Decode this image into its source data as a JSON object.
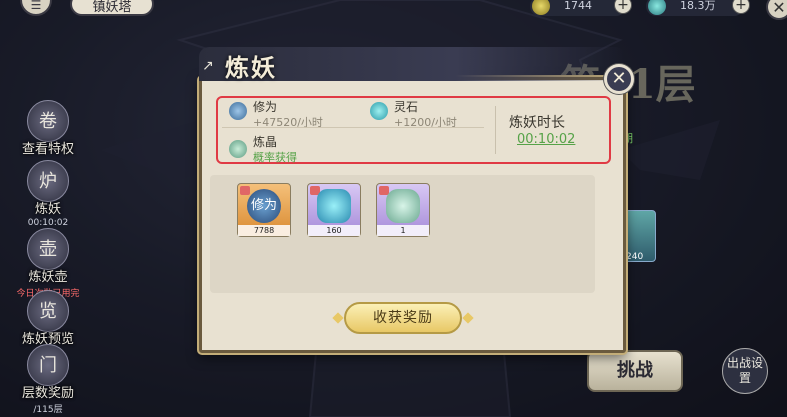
{
  "topbar": {
    "location": "镇妖塔",
    "resource_a": "1744",
    "resource_b": "18.3万"
  },
  "sidebar": {
    "items": [
      {
        "label": "查看特权",
        "sub": "",
        "icon": "scroll-icon"
      },
      {
        "label": "炼妖",
        "sub": "00:10:02",
        "icon": "furnace-icon"
      },
      {
        "label": "炼妖壶",
        "sub": "今日次数已用完",
        "icon": "gourd-icon"
      },
      {
        "label": "炼妖预览",
        "sub": "",
        "icon": "preview-icon"
      },
      {
        "label": "层数奖励",
        "sub": "/115层",
        "icon": "gate-icon"
      }
    ]
  },
  "background": {
    "layer_title": "第11层",
    "right_note": "期",
    "right_card_count": "240",
    "challenge_label": "挑战",
    "battle_setting_label": "出战设置"
  },
  "modal": {
    "title": "炼妖",
    "close_icon": "close-icon",
    "income": [
      {
        "name": "修为",
        "rate": "+47520/小时",
        "icon": "cultivation-icon"
      },
      {
        "name": "灵石",
        "rate": "+1200/小时",
        "icon": "spirit-stone-icon"
      }
    ],
    "crystal": {
      "name": "炼晶",
      "note": "概率获得",
      "icon": "crystal-icon"
    },
    "duration_label": "炼妖时长",
    "duration_value": "00:10:02",
    "rewards": [
      {
        "glyph": "修为",
        "count": "7788",
        "color": "#e8a24a"
      },
      {
        "glyph": "",
        "count": "160",
        "color": "#b79be0"
      },
      {
        "glyph": "",
        "count": "1",
        "color": "#b79be0"
      }
    ],
    "collect_label": "收获奖励"
  }
}
